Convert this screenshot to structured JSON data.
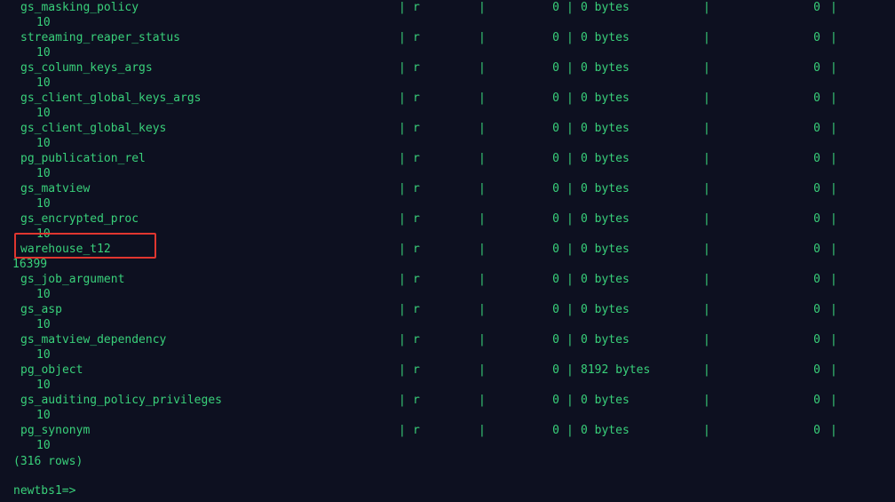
{
  "terminal": {
    "rows": [
      {
        "name": "gs_masking_policy",
        "kind": "r",
        "val1": "0",
        "size": "0 bytes",
        "val2": "0",
        "wrap": "10"
      },
      {
        "name": "streaming_reaper_status",
        "kind": "r",
        "val1": "0",
        "size": "0 bytes",
        "val2": "0",
        "wrap": "10"
      },
      {
        "name": "gs_column_keys_args",
        "kind": "r",
        "val1": "0",
        "size": "0 bytes",
        "val2": "0",
        "wrap": "10"
      },
      {
        "name": "gs_client_global_keys_args",
        "kind": "r",
        "val1": "0",
        "size": "0 bytes",
        "val2": "0",
        "wrap": "10"
      },
      {
        "name": "gs_client_global_keys",
        "kind": "r",
        "val1": "0",
        "size": "0 bytes",
        "val2": "0",
        "wrap": "10"
      },
      {
        "name": "pg_publication_rel",
        "kind": "r",
        "val1": "0",
        "size": "0 bytes",
        "val2": "0",
        "wrap": "10"
      },
      {
        "name": "gs_matview",
        "kind": "r",
        "val1": "0",
        "size": "0 bytes",
        "val2": "0",
        "wrap": "10"
      },
      {
        "name": "gs_encrypted_proc",
        "kind": "r",
        "val1": "0",
        "size": "0 bytes",
        "val2": "0",
        "wrap": "10"
      },
      {
        "name": "warehouse_t12",
        "kind": "r",
        "val1": "0",
        "size": "0 bytes",
        "val2": "0",
        "wrap": "16399"
      },
      {
        "name": "gs_job_argument",
        "kind": "r",
        "val1": "0",
        "size": "0 bytes",
        "val2": "0",
        "wrap": "10"
      },
      {
        "name": "gs_asp",
        "kind": "r",
        "val1": "0",
        "size": "0 bytes",
        "val2": "0",
        "wrap": "10"
      },
      {
        "name": "gs_matview_dependency",
        "kind": "r",
        "val1": "0",
        "size": "0 bytes",
        "val2": "0",
        "wrap": "10"
      },
      {
        "name": "pg_object",
        "kind": "r",
        "val1": "0",
        "size": "8192 bytes",
        "val2": "0",
        "wrap": "10"
      },
      {
        "name": "gs_auditing_policy_privileges",
        "kind": "r",
        "val1": "0",
        "size": "0 bytes",
        "val2": "0",
        "wrap": "10"
      },
      {
        "name": "pg_synonym",
        "kind": "r",
        "val1": "0",
        "size": "0 bytes",
        "val2": "0",
        "wrap": "10"
      }
    ],
    "separator": "|",
    "row_count": "(316 rows)",
    "prompt": "newtbs1=>",
    "highlight_color": "#e0362f",
    "text_color": "#39d07a",
    "background_color": "#0d1020"
  }
}
